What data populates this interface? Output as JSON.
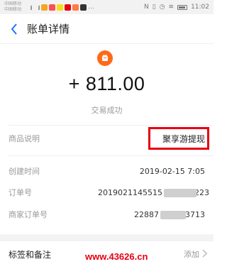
{
  "status_bar": {
    "carrier_1": "中国移动",
    "carrier_2": "中国移动",
    "time": "11:02"
  },
  "header": {
    "title": "账单详情"
  },
  "merchant": {
    "logo_icon": "merchant-logo-icon"
  },
  "summary": {
    "amount": "+ 811.00",
    "status": "交易成功"
  },
  "details": {
    "product_label": "商品说明",
    "product_value": "聚享游提现",
    "created_label": "创建时间",
    "created_value": "2019-02-15  7:05",
    "order_label": "订单号",
    "order_value": "2019021145515",
    "order_suffix": "223",
    "merchant_order_label": "商家订单号",
    "merchant_order_value": "22887",
    "merchant_order_suffix": "3713"
  },
  "tags": {
    "label": "标签和备注",
    "action": "添加"
  },
  "watermark": "www.43626.cn",
  "colors": {
    "accent": "#1677ff",
    "logo": "#ff6a1a",
    "highlight": "#e60012"
  }
}
